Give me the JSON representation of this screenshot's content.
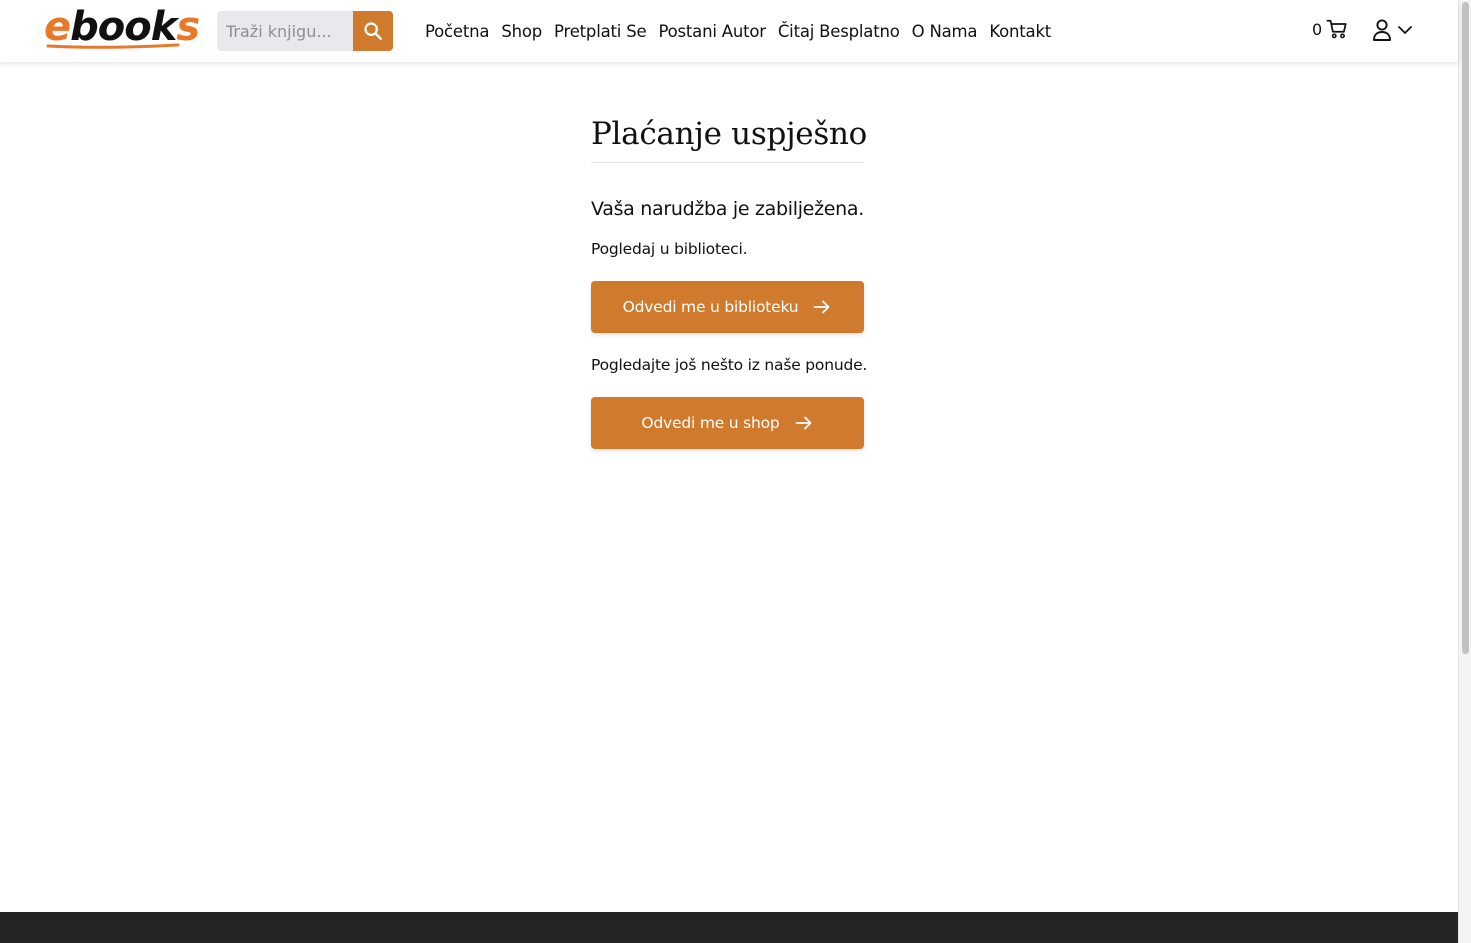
{
  "header": {
    "logo_text": "ebooks",
    "logo_e": "e",
    "logo_books": "book",
    "logo_s": "s",
    "search": {
      "placeholder": "Traži knjigu..."
    },
    "nav": [
      {
        "label": "Početna"
      },
      {
        "label": "Shop"
      },
      {
        "label": "Pretplati Se"
      },
      {
        "label": "Postani Autor"
      },
      {
        "label": "Čitaj Besplatno"
      },
      {
        "label": "O Nama"
      },
      {
        "label": "Kontakt"
      }
    ],
    "cart_count": "0"
  },
  "main": {
    "title": "Plaćanje uspješno",
    "lead": "Vaša narudžba je zabilježena.",
    "library_text": "Pogledaj u biblioteci.",
    "library_button": "Odvedi me u biblioteku",
    "shop_text": "Pogledajte još nešto iz naše ponude.",
    "shop_button": "Odvedi me u shop"
  },
  "icons": {
    "search": "search-icon",
    "cart": "cart-icon",
    "user": "user-icon",
    "chevron": "chevron-down-icon",
    "arrow": "arrow-right-icon"
  },
  "colors": {
    "accent": "#cf7a2c",
    "logo_orange": "#e8792b",
    "footer": "#252525",
    "search_bg": "#e8e9ec"
  }
}
